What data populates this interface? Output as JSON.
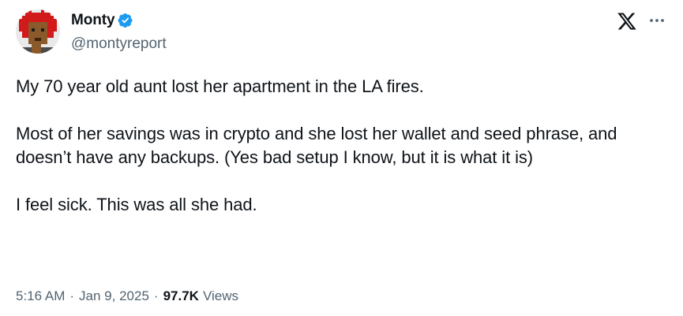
{
  "author": {
    "display_name": "Monty",
    "handle": "@montyreport",
    "verified": true,
    "avatar_icon": "pixel-punk-avatar-icon"
  },
  "header": {
    "brand_icon": "x-logo-icon",
    "more_icon": "more-horizontal-icon"
  },
  "tweet": {
    "paragraphs": [
      "My 70 year old aunt lost her apartment in the LA fires.",
      "Most of her savings was in crypto and she lost her wallet and seed phrase, and doesn’t have any backups. (Yes bad setup I know, but it is what it is)",
      "I feel sick. This was all she had."
    ]
  },
  "meta": {
    "time": "5:16 AM",
    "separator": "·",
    "date": "Jan 9, 2025",
    "views_count": "97.7K",
    "views_label": "Views"
  },
  "colors": {
    "text_primary": "#0f1419",
    "text_secondary": "#536471",
    "verified_blue": "#1d9bf0",
    "background": "#ffffff"
  }
}
